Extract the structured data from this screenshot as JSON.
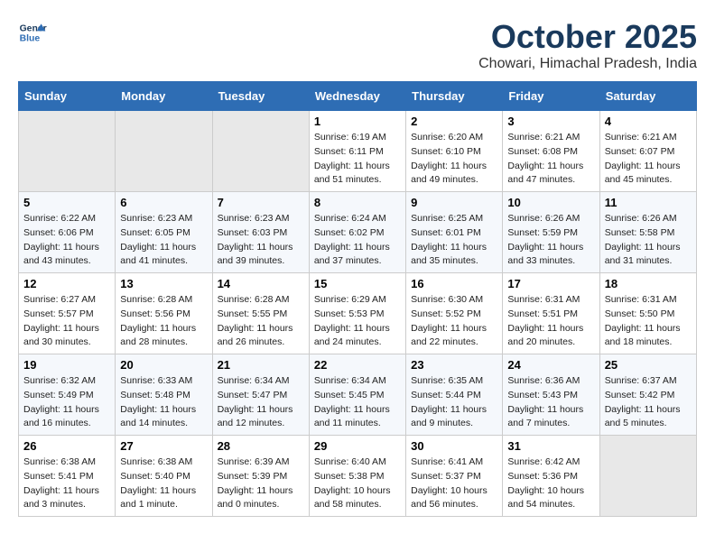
{
  "header": {
    "logo_line1": "General",
    "logo_line2": "Blue",
    "month": "October 2025",
    "location": "Chowari, Himachal Pradesh, India"
  },
  "days_of_week": [
    "Sunday",
    "Monday",
    "Tuesday",
    "Wednesday",
    "Thursday",
    "Friday",
    "Saturday"
  ],
  "weeks": [
    [
      {
        "day": "",
        "sunrise": "",
        "sunset": "",
        "daylight": "",
        "empty": true
      },
      {
        "day": "",
        "sunrise": "",
        "sunset": "",
        "daylight": "",
        "empty": true
      },
      {
        "day": "",
        "sunrise": "",
        "sunset": "",
        "daylight": "",
        "empty": true
      },
      {
        "day": "1",
        "sunrise": "Sunrise: 6:19 AM",
        "sunset": "Sunset: 6:11 PM",
        "daylight": "Daylight: 11 hours and 51 minutes."
      },
      {
        "day": "2",
        "sunrise": "Sunrise: 6:20 AM",
        "sunset": "Sunset: 6:10 PM",
        "daylight": "Daylight: 11 hours and 49 minutes."
      },
      {
        "day": "3",
        "sunrise": "Sunrise: 6:21 AM",
        "sunset": "Sunset: 6:08 PM",
        "daylight": "Daylight: 11 hours and 47 minutes."
      },
      {
        "day": "4",
        "sunrise": "Sunrise: 6:21 AM",
        "sunset": "Sunset: 6:07 PM",
        "daylight": "Daylight: 11 hours and 45 minutes."
      }
    ],
    [
      {
        "day": "5",
        "sunrise": "Sunrise: 6:22 AM",
        "sunset": "Sunset: 6:06 PM",
        "daylight": "Daylight: 11 hours and 43 minutes."
      },
      {
        "day": "6",
        "sunrise": "Sunrise: 6:23 AM",
        "sunset": "Sunset: 6:05 PM",
        "daylight": "Daylight: 11 hours and 41 minutes."
      },
      {
        "day": "7",
        "sunrise": "Sunrise: 6:23 AM",
        "sunset": "Sunset: 6:03 PM",
        "daylight": "Daylight: 11 hours and 39 minutes."
      },
      {
        "day": "8",
        "sunrise": "Sunrise: 6:24 AM",
        "sunset": "Sunset: 6:02 PM",
        "daylight": "Daylight: 11 hours and 37 minutes."
      },
      {
        "day": "9",
        "sunrise": "Sunrise: 6:25 AM",
        "sunset": "Sunset: 6:01 PM",
        "daylight": "Daylight: 11 hours and 35 minutes."
      },
      {
        "day": "10",
        "sunrise": "Sunrise: 6:26 AM",
        "sunset": "Sunset: 5:59 PM",
        "daylight": "Daylight: 11 hours and 33 minutes."
      },
      {
        "day": "11",
        "sunrise": "Sunrise: 6:26 AM",
        "sunset": "Sunset: 5:58 PM",
        "daylight": "Daylight: 11 hours and 31 minutes."
      }
    ],
    [
      {
        "day": "12",
        "sunrise": "Sunrise: 6:27 AM",
        "sunset": "Sunset: 5:57 PM",
        "daylight": "Daylight: 11 hours and 30 minutes."
      },
      {
        "day": "13",
        "sunrise": "Sunrise: 6:28 AM",
        "sunset": "Sunset: 5:56 PM",
        "daylight": "Daylight: 11 hours and 28 minutes."
      },
      {
        "day": "14",
        "sunrise": "Sunrise: 6:28 AM",
        "sunset": "Sunset: 5:55 PM",
        "daylight": "Daylight: 11 hours and 26 minutes."
      },
      {
        "day": "15",
        "sunrise": "Sunrise: 6:29 AM",
        "sunset": "Sunset: 5:53 PM",
        "daylight": "Daylight: 11 hours and 24 minutes."
      },
      {
        "day": "16",
        "sunrise": "Sunrise: 6:30 AM",
        "sunset": "Sunset: 5:52 PM",
        "daylight": "Daylight: 11 hours and 22 minutes."
      },
      {
        "day": "17",
        "sunrise": "Sunrise: 6:31 AM",
        "sunset": "Sunset: 5:51 PM",
        "daylight": "Daylight: 11 hours and 20 minutes."
      },
      {
        "day": "18",
        "sunrise": "Sunrise: 6:31 AM",
        "sunset": "Sunset: 5:50 PM",
        "daylight": "Daylight: 11 hours and 18 minutes."
      }
    ],
    [
      {
        "day": "19",
        "sunrise": "Sunrise: 6:32 AM",
        "sunset": "Sunset: 5:49 PM",
        "daylight": "Daylight: 11 hours and 16 minutes."
      },
      {
        "day": "20",
        "sunrise": "Sunrise: 6:33 AM",
        "sunset": "Sunset: 5:48 PM",
        "daylight": "Daylight: 11 hours and 14 minutes."
      },
      {
        "day": "21",
        "sunrise": "Sunrise: 6:34 AM",
        "sunset": "Sunset: 5:47 PM",
        "daylight": "Daylight: 11 hours and 12 minutes."
      },
      {
        "day": "22",
        "sunrise": "Sunrise: 6:34 AM",
        "sunset": "Sunset: 5:45 PM",
        "daylight": "Daylight: 11 hours and 11 minutes."
      },
      {
        "day": "23",
        "sunrise": "Sunrise: 6:35 AM",
        "sunset": "Sunset: 5:44 PM",
        "daylight": "Daylight: 11 hours and 9 minutes."
      },
      {
        "day": "24",
        "sunrise": "Sunrise: 6:36 AM",
        "sunset": "Sunset: 5:43 PM",
        "daylight": "Daylight: 11 hours and 7 minutes."
      },
      {
        "day": "25",
        "sunrise": "Sunrise: 6:37 AM",
        "sunset": "Sunset: 5:42 PM",
        "daylight": "Daylight: 11 hours and 5 minutes."
      }
    ],
    [
      {
        "day": "26",
        "sunrise": "Sunrise: 6:38 AM",
        "sunset": "Sunset: 5:41 PM",
        "daylight": "Daylight: 11 hours and 3 minutes."
      },
      {
        "day": "27",
        "sunrise": "Sunrise: 6:38 AM",
        "sunset": "Sunset: 5:40 PM",
        "daylight": "Daylight: 11 hours and 1 minute."
      },
      {
        "day": "28",
        "sunrise": "Sunrise: 6:39 AM",
        "sunset": "Sunset: 5:39 PM",
        "daylight": "Daylight: 11 hours and 0 minutes."
      },
      {
        "day": "29",
        "sunrise": "Sunrise: 6:40 AM",
        "sunset": "Sunset: 5:38 PM",
        "daylight": "Daylight: 10 hours and 58 minutes."
      },
      {
        "day": "30",
        "sunrise": "Sunrise: 6:41 AM",
        "sunset": "Sunset: 5:37 PM",
        "daylight": "Daylight: 10 hours and 56 minutes."
      },
      {
        "day": "31",
        "sunrise": "Sunrise: 6:42 AM",
        "sunset": "Sunset: 5:36 PM",
        "daylight": "Daylight: 10 hours and 54 minutes."
      },
      {
        "day": "",
        "sunrise": "",
        "sunset": "",
        "daylight": "",
        "empty": true
      }
    ]
  ]
}
